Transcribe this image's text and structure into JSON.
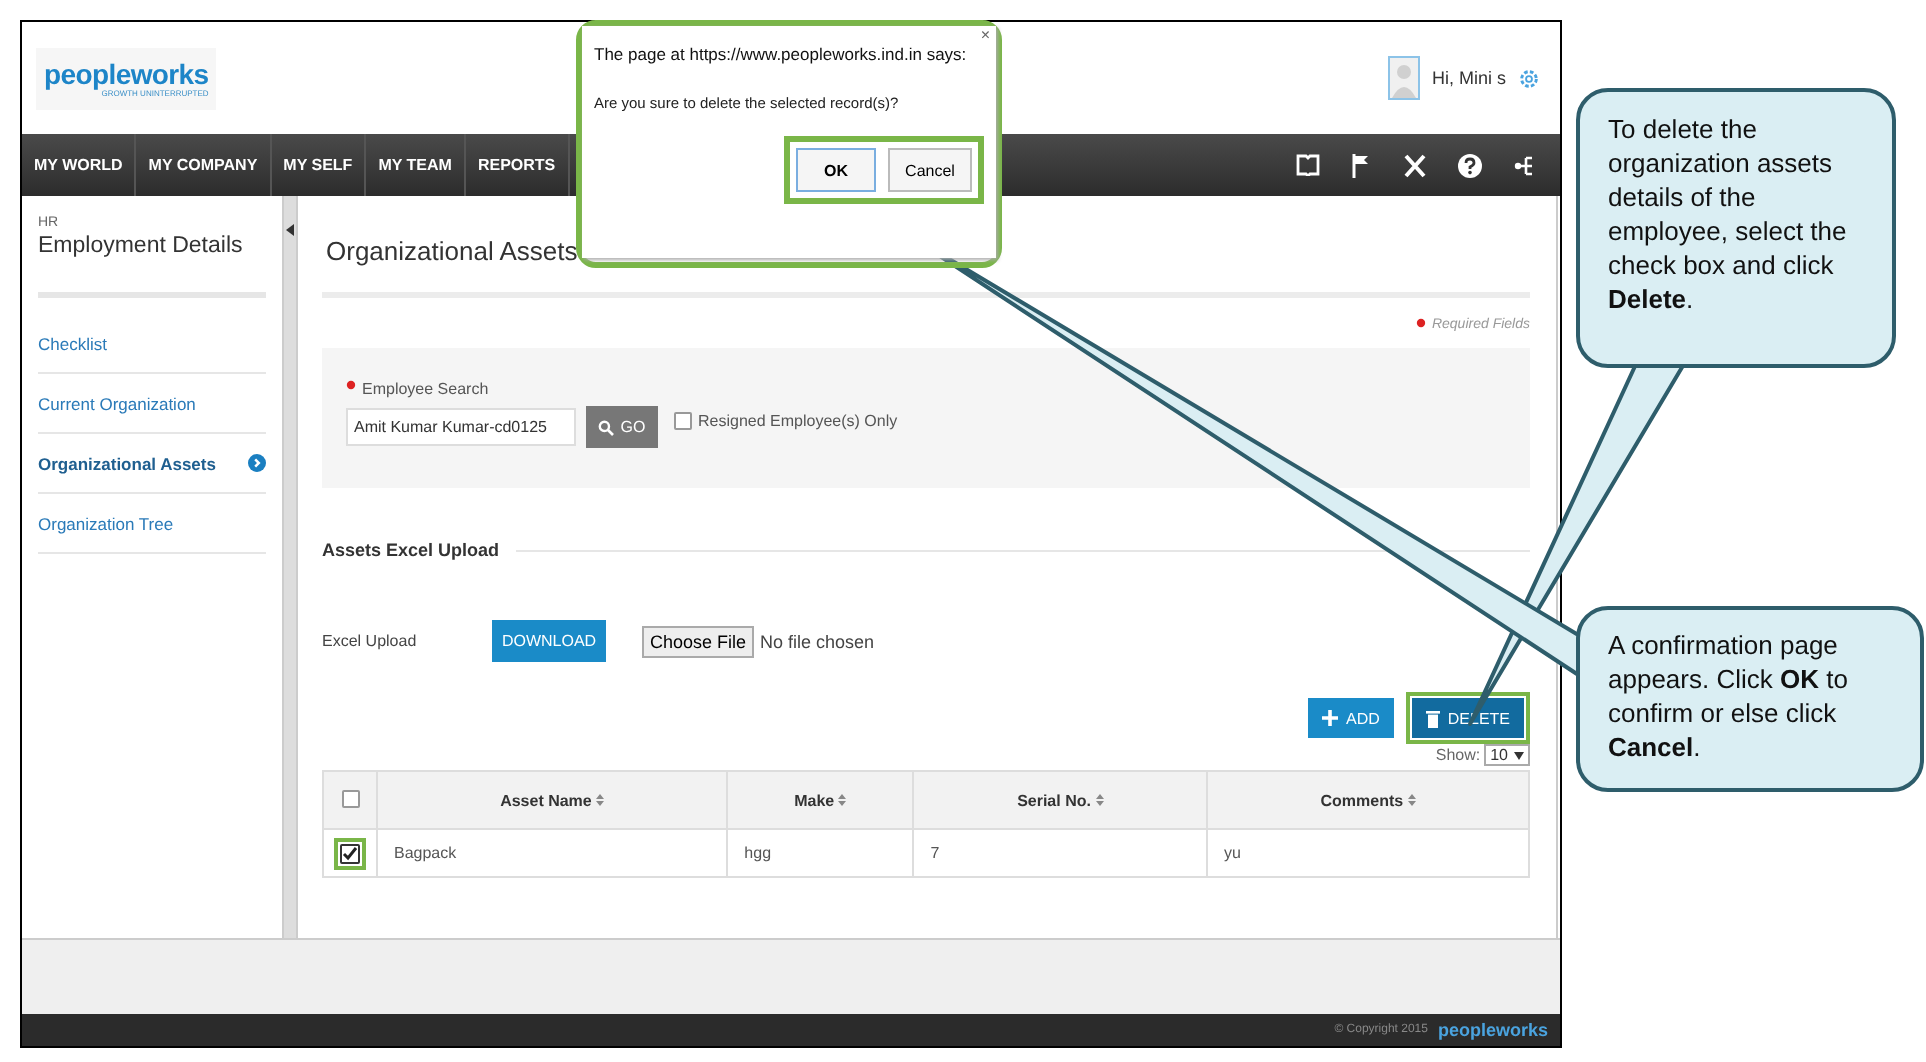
{
  "logo": {
    "name": "peopleworks",
    "tagline": "GROWTH UNINTERRUPTED"
  },
  "user": {
    "greeting": "Hi, Mini s"
  },
  "nav": {
    "items": [
      "MY WORLD",
      "MY COMPANY",
      "MY SELF",
      "MY TEAM",
      "REPORTS"
    ]
  },
  "sidebar": {
    "section": "HR",
    "title": "Employment Details",
    "items": [
      {
        "label": "Checklist",
        "selected": false
      },
      {
        "label": "Current Organization",
        "selected": false
      },
      {
        "label": "Organizational Assets",
        "selected": true
      },
      {
        "label": "Organization Tree",
        "selected": false
      }
    ]
  },
  "page": {
    "title": "Organizational Assets",
    "required_note": "Required Fields",
    "search": {
      "label": "Employee Search",
      "value": "Amit Kumar Kumar-cd0125",
      "go": "GO",
      "resigned": {
        "label": "Resigned Employee(s) Only",
        "checked": false
      }
    },
    "upload": {
      "heading": "Assets Excel Upload",
      "label": "Excel Upload",
      "download": "DOWNLOAD",
      "choose": "Choose File",
      "file_status": "No file chosen"
    },
    "actions": {
      "add": "ADD",
      "delete": "DELETE"
    },
    "show": {
      "label": "Show:",
      "value": "10"
    },
    "table": {
      "select_all_checked": false,
      "columns": [
        "Asset Name",
        "Make",
        "Serial No.",
        "Comments"
      ],
      "rows": [
        {
          "checked": true,
          "cells": [
            "Bagpack",
            "hgg",
            "7",
            "yu"
          ]
        }
      ]
    }
  },
  "footer": {
    "copyright": "© Copyright 2015",
    "brand": "peopleworks"
  },
  "dialog": {
    "title": "The page at https://www.peopleworks.ind.in says:",
    "message": "Are you sure to delete the selected record(s)?",
    "close": "×",
    "buttons": [
      "OK",
      "Cancel"
    ]
  },
  "callouts": [
    "To delete the organization assets details of the employee, select the check box and click **Delete**.",
    "A confirmation page appears. Click **OK** to confirm or else click **Cancel**."
  ]
}
